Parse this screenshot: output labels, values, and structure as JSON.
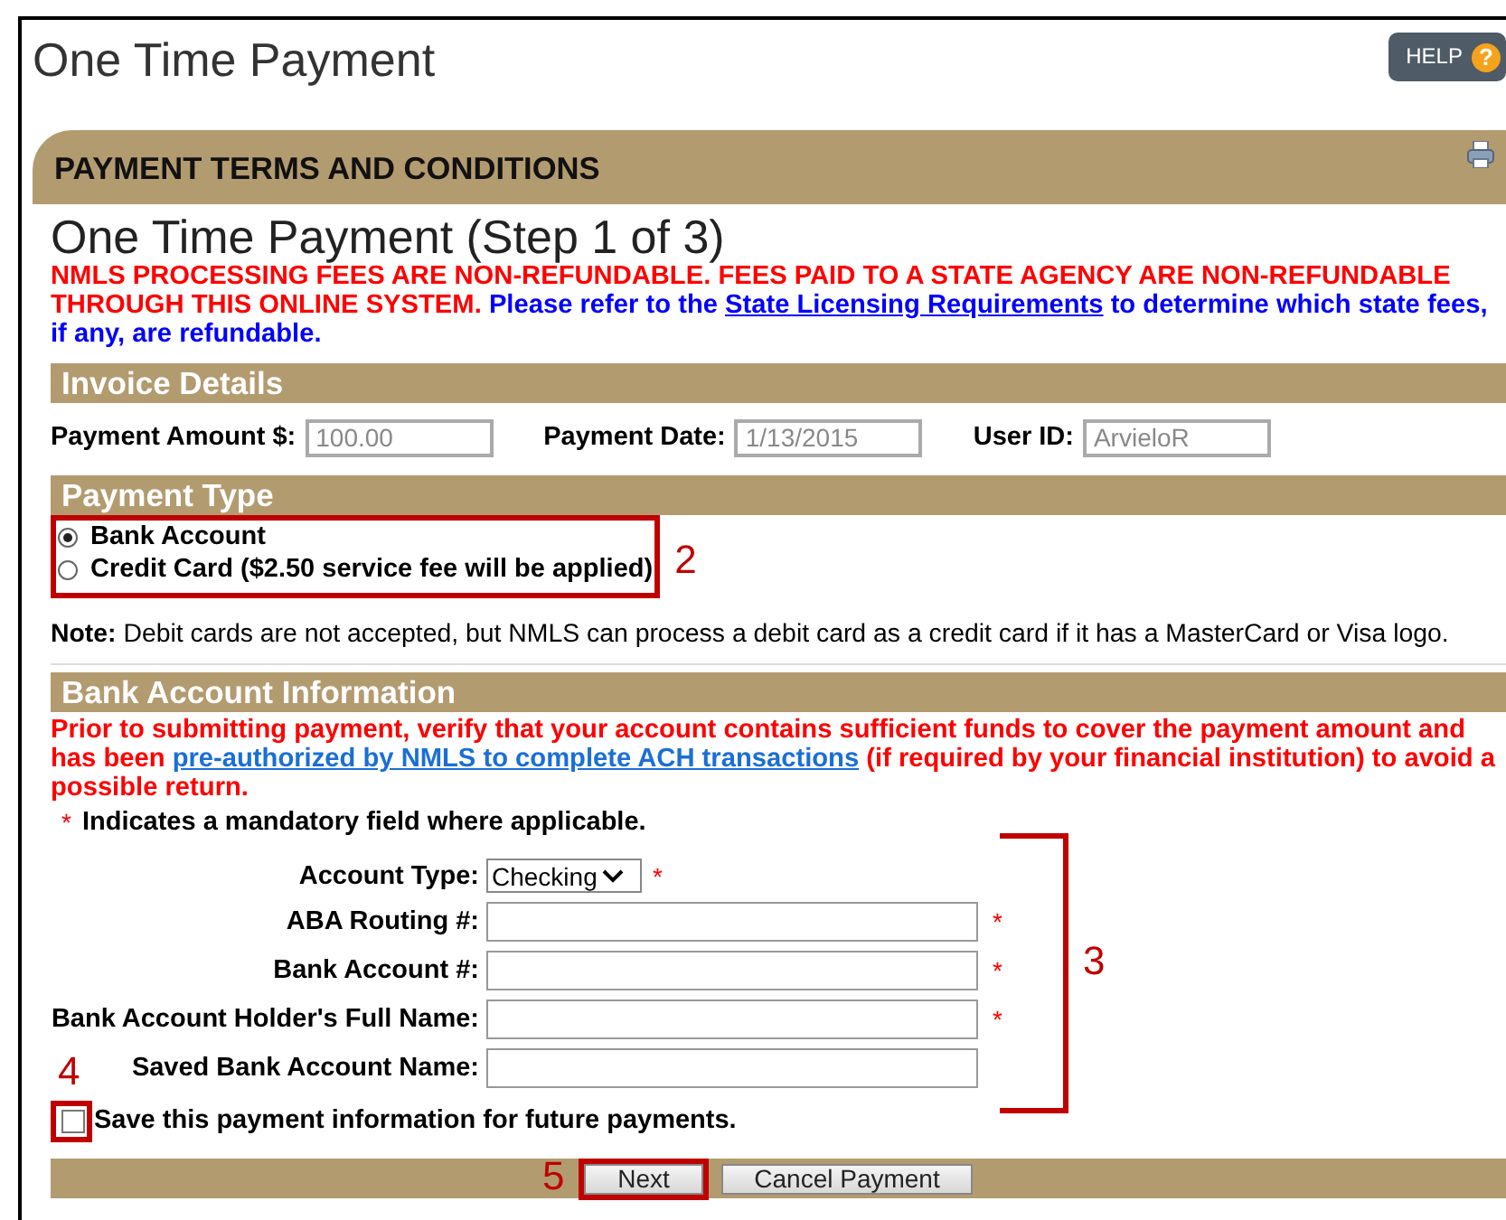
{
  "page": {
    "title": "One Time Payment",
    "help_button": "HELP",
    "help_icon": "?"
  },
  "terms_header": "PAYMENT TERMS AND CONDITIONS",
  "step_title": "One Time Payment (Step 1 of 3)",
  "fee_notice": {
    "warning": "NMLS PROCESSING FEES ARE NON-REFUNDABLE. FEES PAID TO A STATE AGENCY ARE NON-REFUNDABLE THROUGH THIS ONLINE SYSTEM.",
    "before_link": "Please refer to the",
    "link": "State Licensing Requirements",
    "after_link": "to determine which state fees, if any, are refundable."
  },
  "invoice": {
    "title": "Invoice Details",
    "fields": [
      {
        "label": "Payment Amount $:",
        "value": "100.00"
      },
      {
        "label": "Payment Date:",
        "value": "1/13/2015"
      },
      {
        "label": "User ID:",
        "value": "ArvieloR"
      }
    ]
  },
  "payment_type": {
    "title": "Payment Type",
    "options": [
      {
        "label": "Bank Account",
        "selected": true
      },
      {
        "label": "Credit Card ($2.50 service fee will be applied)",
        "selected": false
      }
    ]
  },
  "note": "**Note:** Debit cards are not accepted, but NMLS can process a debit card as a credit card if it has a MasterCard or Visa logo.",
  "bank": {
    "title": "Bank Account Information",
    "before_link": "Prior to submitting payment, verify that your account contains sufficient funds to cover the payment amount and has been",
    "link": "pre-authorized by NMLS to complete ACH transactions",
    "after_link": "(if required by your financial institution) to avoid a possible return.",
    "mandatory_mark": "*",
    "mandatory_text": "Indicates a mandatory field where applicable.",
    "fields": [
      {
        "kind": "select",
        "label": "Account Type:",
        "value": "Checking",
        "required_mark": "*"
      },
      {
        "kind": "text",
        "label": "ABA Routing #:",
        "required_mark": "*"
      },
      {
        "kind": "text",
        "label": "Bank Account #:",
        "required_mark": "*"
      },
      {
        "kind": "text",
        "label": "Bank Account Holder's Full Name:",
        "required_mark": "*"
      },
      {
        "kind": "text",
        "label": "Saved Bank Account Name:"
      }
    ]
  },
  "save_option": {
    "label": "Save this payment information for future payments.",
    "checked": false
  },
  "buttons": [
    {
      "label": "Next"
    },
    {
      "label": "Cancel Payment"
    }
  ],
  "callouts": [
    {
      "number": "2"
    },
    {
      "number": "3"
    },
    {
      "number": "4"
    },
    {
      "number": "5"
    }
  ]
}
